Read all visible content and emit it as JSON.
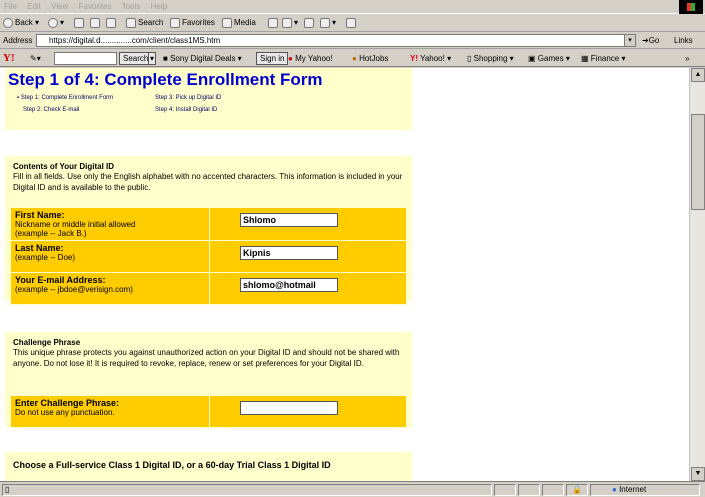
{
  "menu": [
    "File",
    "Edit",
    "View",
    "Favorites",
    "Tools",
    "Help"
  ],
  "toolbar": {
    "back": "Back",
    "search": "Search",
    "favorites": "Favorites",
    "media": "Media"
  },
  "address": {
    "label": "Address",
    "url": "https://digital.d..............com/client/class1MS.htm",
    "go": "Go",
    "links": "Links"
  },
  "yahoo": {
    "search_btn": "Search",
    "items": [
      "Sony Digital Deals",
      "Sign in",
      "My Yahoo!",
      "HotJobs",
      "Yahoo!",
      "Shopping",
      "Games",
      "Finance"
    ]
  },
  "page": {
    "title": "Step 1 of 4: Complete Enrollment Form",
    "steps": [
      "Step 1: Complete Enrollment Form",
      "Step 2: Check E-mail",
      "Step 3: Pick up Digital ID",
      "Step 4: Install Digital ID"
    ],
    "contents": {
      "title": "Contents of Your Digital ID",
      "desc": "Fill in all fields. Use only the English alphabet with no accented characters. This information is included in your Digital ID and is available to the public."
    },
    "fields": [
      {
        "label": "First Name:",
        "hint1": "Nickname or middle initial allowed",
        "hint2": "(example -- Jack B.)",
        "value": "Shlomo"
      },
      {
        "label": "Last Name:",
        "hint1": "(example -- Doe)",
        "hint2": "",
        "value": "Kipnis"
      },
      {
        "label": "Your E-mail Address:",
        "hint1": "(example -- jbdoe@verisign.com)",
        "hint2": "",
        "value": "shlomo@hotmail"
      }
    ],
    "challenge": {
      "title": "Challenge Phrase",
      "desc": "This unique phrase protects you against unauthorized action on your Digital ID and should not be shared with anyone. Do not lose it! It is required to revoke, replace, renew or set preferences for your Digital ID.",
      "label": "Enter Challenge Phrase:",
      "hint": "Do not use any punctuation.",
      "value": ""
    },
    "choose": "Choose a Full-service Class 1 Digital ID, or a 60-day Trial Class 1 Digital ID"
  },
  "status": {
    "zone": "Internet"
  }
}
